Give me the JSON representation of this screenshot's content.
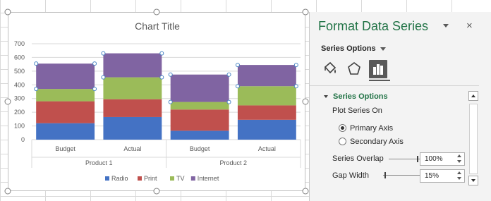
{
  "chart_data": {
    "type": "bar",
    "stacked": true,
    "title": "Chart Title",
    "categories": [
      "Budget",
      "Actual",
      "Budget",
      "Actual"
    ],
    "groups": [
      "Product 1",
      "Product 2"
    ],
    "yticks": [
      "0",
      "100",
      "200",
      "300",
      "400",
      "500",
      "600",
      "700"
    ],
    "ylim": [
      0,
      700
    ],
    "series": [
      {
        "name": "Radio",
        "color": "#4472c4",
        "values": [
          120,
          165,
          65,
          145
        ]
      },
      {
        "name": "Print",
        "color": "#c0504d",
        "values": [
          160,
          130,
          155,
          105
        ]
      },
      {
        "name": "TV",
        "color": "#9bbb59",
        "values": [
          90,
          160,
          55,
          140
        ]
      },
      {
        "name": "Internet",
        "color": "#8064a2",
        "values": [
          185,
          175,
          200,
          155
        ]
      }
    ],
    "grid": true,
    "legend_position": "bottom",
    "overlap": "100%",
    "gap_width": "15%"
  },
  "pane": {
    "title": "Format Data Series",
    "close_glyph": "×",
    "series_options_label": "Series Options",
    "section_header": "Series Options",
    "plot_series_on": "Plot Series On",
    "primary_axis": "Primary Axis",
    "secondary_axis": "Secondary Axis",
    "primary_selected": true,
    "series_overlap_label": "Series Overlap",
    "series_overlap_value": "100%",
    "gap_width_label": "Gap Width",
    "gap_width_value": "15%",
    "tab_icons": [
      "fill-line-icon",
      "effects-icon",
      "series-options-icon"
    ]
  }
}
